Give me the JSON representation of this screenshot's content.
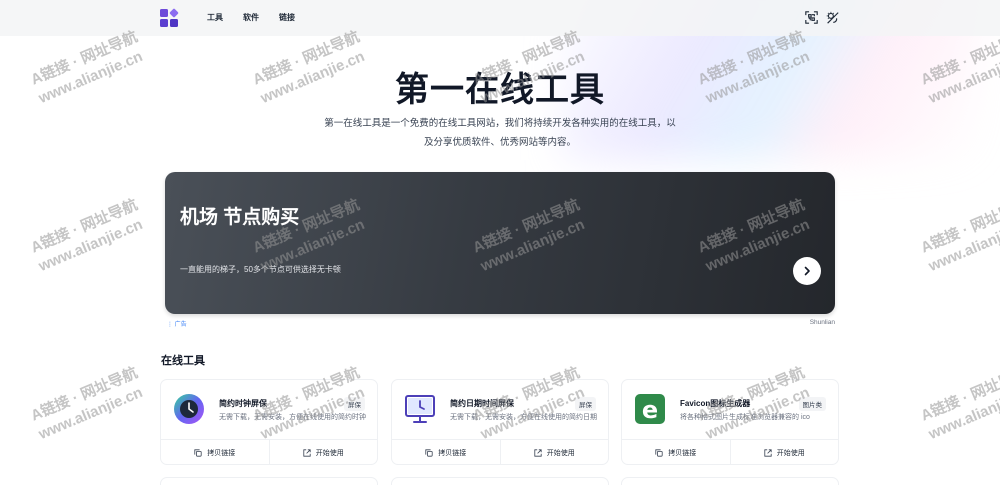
{
  "header": {
    "nav": [
      "工具",
      "软件",
      "链接"
    ],
    "icons": [
      "qr-scan-icon",
      "theme-toggle-icon"
    ]
  },
  "hero": {
    "title": "第一在线工具",
    "desc_line1": "第一在线工具是一个免费的在线工具网站，我们将持续开发各种实用的在线工具，以",
    "desc_line2": "及分享优质软件、优秀网站等内容。"
  },
  "banner": {
    "title": "机场 节点购买",
    "subtitle": "一直能用的梯子，50多个节点可供选择无卡顿",
    "ad_label": "广告",
    "brand": "Shunlian"
  },
  "section": {
    "title": "在线工具"
  },
  "tools": [
    {
      "name": "简约时钟屏保",
      "tag": "屏保",
      "desc": "无需下载，无需安装，方便在线使用的简约时钟",
      "icon": "clock-icon",
      "copy": "拷贝链接",
      "open": "开始使用"
    },
    {
      "name": "简约日期时间屏保",
      "tag": "屏保",
      "desc": "无需下载，无需安装，方便在线使用的简约日期",
      "icon": "monitor-clock-icon",
      "copy": "拷贝链接",
      "open": "开始使用"
    },
    {
      "name": "Favicon图标生成器",
      "tag": "图片类",
      "desc": "将各种格式图片生成标准浏览器兼容的 ico",
      "icon": "favicon-e-icon",
      "copy": "拷贝链接",
      "open": "开始使用"
    }
  ],
  "watermark": {
    "line1": "A链接 · 网址导航",
    "line2": "www.alianjie.cn"
  },
  "colors": {
    "accent": "#6d4ad9",
    "banner_dark": "#24272c",
    "ad_blue": "#3b82f6"
  }
}
